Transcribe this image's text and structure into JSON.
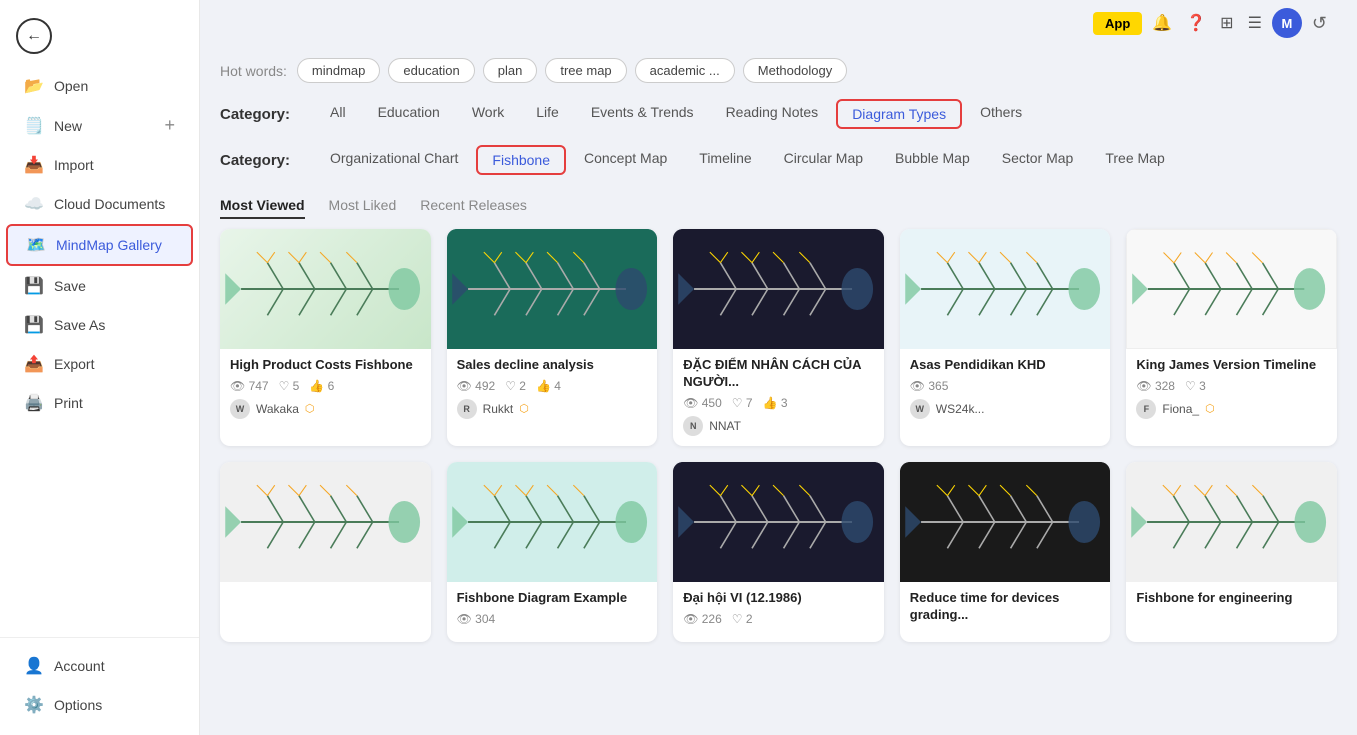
{
  "sidebar": {
    "back_icon": "←",
    "items": [
      {
        "id": "open",
        "label": "Open",
        "icon": "📂",
        "plus": false,
        "active": false
      },
      {
        "id": "new",
        "label": "New",
        "icon": "🗒️",
        "plus": true,
        "active": false
      },
      {
        "id": "import",
        "label": "Import",
        "icon": "📥",
        "plus": false,
        "active": false
      },
      {
        "id": "cloud",
        "label": "Cloud Documents",
        "icon": "☁️",
        "plus": false,
        "active": false
      },
      {
        "id": "mindmap-gallery",
        "label": "MindMap Gallery",
        "icon": "🗺️",
        "plus": false,
        "active": true,
        "highlight": true
      },
      {
        "id": "save",
        "label": "Save",
        "icon": "💾",
        "plus": false,
        "active": false
      },
      {
        "id": "save-as",
        "label": "Save As",
        "icon": "💾",
        "plus": false,
        "active": false
      },
      {
        "id": "export",
        "label": "Export",
        "icon": "📤",
        "plus": false,
        "active": false
      },
      {
        "id": "print",
        "label": "Print",
        "icon": "🖨️",
        "plus": false,
        "active": false
      }
    ],
    "bottom_items": [
      {
        "id": "account",
        "label": "Account",
        "icon": "👤"
      },
      {
        "id": "options",
        "label": "Options",
        "icon": "⚙️"
      }
    ]
  },
  "topbar": {
    "app_label": "App",
    "avatar_letter": "M",
    "icons": [
      "🔔",
      "❓",
      "⊞",
      "☰"
    ]
  },
  "hot_words": {
    "label": "Hot words:",
    "tags": [
      "mindmap",
      "education",
      "plan",
      "tree map",
      "academic ...",
      "Methodology"
    ]
  },
  "categories": {
    "label": "Category:",
    "items": [
      {
        "id": "all",
        "label": "All"
      },
      {
        "id": "education",
        "label": "Education"
      },
      {
        "id": "work",
        "label": "Work"
      },
      {
        "id": "life",
        "label": "Life"
      },
      {
        "id": "events",
        "label": "Events & Trends"
      },
      {
        "id": "reading-notes",
        "label": "Reading Notes"
      },
      {
        "id": "diagram-types",
        "label": "Diagram Types",
        "active": true
      },
      {
        "id": "others",
        "label": "Others"
      }
    ]
  },
  "sub_categories": {
    "label": "Category:",
    "items": [
      {
        "id": "org-chart",
        "label": "Organizational Chart"
      },
      {
        "id": "fishbone",
        "label": "Fishbone",
        "active": true
      },
      {
        "id": "concept-map",
        "label": "Concept Map"
      },
      {
        "id": "timeline",
        "label": "Timeline"
      },
      {
        "id": "circular-map",
        "label": "Circular Map"
      },
      {
        "id": "bubble-map",
        "label": "Bubble Map"
      },
      {
        "id": "sector-map",
        "label": "Sector Map"
      },
      {
        "id": "tree-map",
        "label": "Tree Map"
      }
    ]
  },
  "sort_tabs": [
    {
      "id": "most-viewed",
      "label": "Most Viewed",
      "active": true
    },
    {
      "id": "most-liked",
      "label": "Most Liked",
      "active": false
    },
    {
      "id": "recent-releases",
      "label": "Recent Releases",
      "active": false
    }
  ],
  "gallery": {
    "cards": [
      {
        "id": "card-1",
        "title": "High Product Costs Fishbone",
        "thumb_style": "thumb-green",
        "views": "747",
        "likes": "5",
        "shares": "6",
        "author": "Wakaka",
        "author_verified": true,
        "author_initials": "W"
      },
      {
        "id": "card-2",
        "title": "Sales decline analysis",
        "thumb_style": "thumb-teal-dark",
        "views": "492",
        "likes": "2",
        "shares": "4",
        "author": "Rukkt",
        "author_verified": true,
        "author_initials": "R"
      },
      {
        "id": "card-3",
        "title": "ĐẶC ĐIỂM NHÂN CÁCH CỦA NGƯỜI...",
        "thumb_style": "thumb-dark",
        "views": "450",
        "likes": "7",
        "shares": "3",
        "author": "NNAT",
        "author_verified": false,
        "author_initials": "N"
      },
      {
        "id": "card-4",
        "title": "Asas Pendidikan KHD",
        "thumb_style": "thumb-light",
        "views": "365",
        "likes": "",
        "shares": "",
        "author": "WS24k...",
        "author_verified": false,
        "author_initials": "W"
      },
      {
        "id": "card-5",
        "title": "King James Version Timeline",
        "thumb_style": "thumb-white",
        "views": "328",
        "likes": "3",
        "shares": "",
        "author": "Fiona_",
        "author_verified": true,
        "author_initials": "F"
      },
      {
        "id": "card-6",
        "title": "",
        "thumb_style": "thumb-white2",
        "views": "",
        "likes": "",
        "shares": "",
        "author": "",
        "author_verified": false,
        "author_initials": ""
      },
      {
        "id": "card-7",
        "title": "Fishbone Diagram Example",
        "thumb_style": "thumb-light-teal",
        "views": "304",
        "likes": "",
        "shares": "",
        "author": "",
        "author_verified": false,
        "author_initials": ""
      },
      {
        "id": "card-8",
        "title": "Đại hội VI (12.1986)",
        "thumb_style": "thumb-dark",
        "views": "226",
        "likes": "2",
        "shares": "",
        "author": "",
        "author_verified": false,
        "author_initials": ""
      },
      {
        "id": "card-9",
        "title": "Reduce time for devices grading...",
        "thumb_style": "thumb-black",
        "views": "",
        "likes": "",
        "shares": "",
        "author": "",
        "author_verified": false,
        "author_initials": ""
      },
      {
        "id": "card-10",
        "title": "Fishbone for engineering",
        "thumb_style": "thumb-white2",
        "views": "",
        "likes": "",
        "shares": "",
        "author": "",
        "author_verified": false,
        "author_initials": ""
      }
    ]
  },
  "icons": {
    "eye": "👁",
    "heart": "♡",
    "share": "👍",
    "back": "←",
    "verified": "⬡"
  }
}
